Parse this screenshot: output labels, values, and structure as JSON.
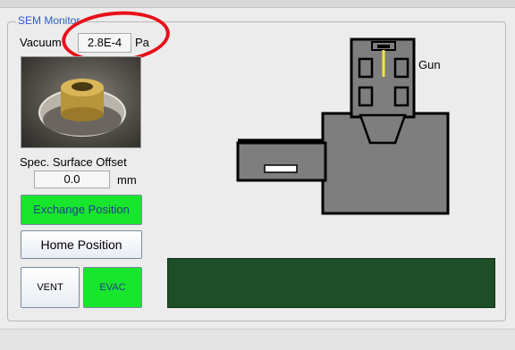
{
  "panel": {
    "title": "SEM Monitor"
  },
  "vacuum": {
    "label": "Vacuum",
    "value": "2.8E-4",
    "unit": "Pa"
  },
  "stage_photo": {
    "icon": "specimen-stage-photo"
  },
  "surface_offset": {
    "label": "Spec. Surface Offset",
    "value": "0.0",
    "unit": "mm"
  },
  "buttons": {
    "exchange": "Exchange Position",
    "home": "Home Position",
    "vent": "VENT",
    "evac": "EVAC"
  },
  "diagram": {
    "gun_label": "Gun"
  },
  "colors": {
    "active_button": "#18e62c",
    "chamber_fill": "#7e7e7e",
    "status_display": "#1e4e26",
    "highlight_ring": "#e8101a",
    "beam": "#f0e838"
  }
}
